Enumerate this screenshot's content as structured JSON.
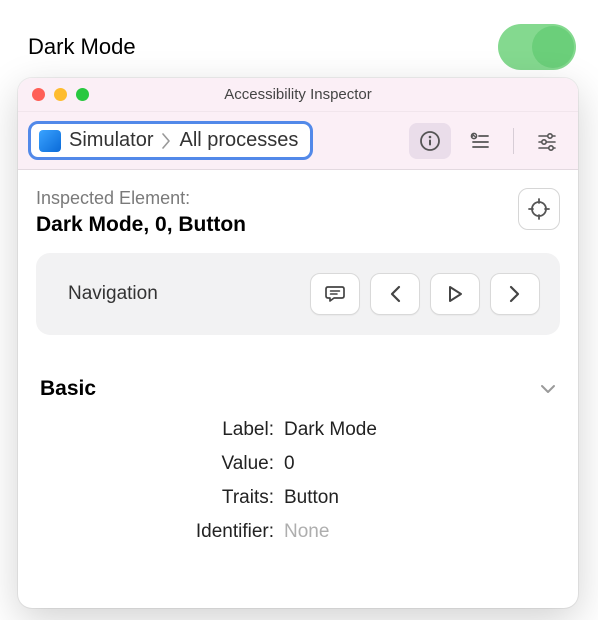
{
  "background": {
    "setting_label": "Dark Mode",
    "toggle_on": true
  },
  "window": {
    "title": "Accessibility Inspector",
    "toolbar": {
      "target_app": "Simulator",
      "target_process": "All processes"
    },
    "inspected": {
      "heading": "Inspected Element:",
      "description": "Dark Mode, 0, Button"
    },
    "navigation": {
      "title": "Navigation"
    },
    "basic": {
      "title": "Basic",
      "rows": {
        "label_key": "Label:",
        "label_val": "Dark Mode",
        "value_key": "Value:",
        "value_val": "0",
        "traits_key": "Traits:",
        "traits_val": "Button",
        "identifier_key": "Identifier:",
        "identifier_val": "None"
      }
    }
  }
}
